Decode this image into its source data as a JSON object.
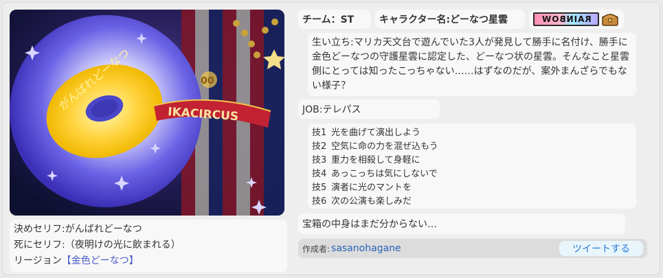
{
  "image": {
    "arc_text": "がんばれどーなつ",
    "banner_text": "IKACIRCUS",
    "badge_text": "00"
  },
  "quotes": {
    "kime_label": "決めセリフ:",
    "kime": "がんばれどーなつ",
    "shini_label": "死にセリフ:",
    "shini": "（夜明けの光に飲まれる）",
    "region_label": "リージョン",
    "region": "【金色どーなつ】"
  },
  "team": {
    "label": "チーム：ST"
  },
  "character": {
    "label": "キャラクター名:どーなつ星雲"
  },
  "badges": {
    "rainbow": "RAINBOW",
    "chest_icon": "treasure-chest"
  },
  "origin": {
    "text": "生い立ち:マリカ天文台で遊んでいた3人が発見して勝手に名付け、勝手に金色どーなつの守護星雲に認定した、どーなつ状の星雲。そんなこと星雲側にとっては知ったこっちゃない……はずなのだが、案外まんざらでもない様子？"
  },
  "job": {
    "text": "JOB:テレパス"
  },
  "skills": [
    {
      "key": "技1",
      "name": "光を曲げて演出しよう"
    },
    {
      "key": "技2",
      "name": "空気に命の力を混ぜ込もう"
    },
    {
      "key": "技3",
      "name": "重力を相殺して身軽に"
    },
    {
      "key": "技4",
      "name": "あっこっちは気にしないで"
    },
    {
      "key": "技5",
      "name": "演者に光のマントを"
    },
    {
      "key": "技6",
      "name": "次の公演も楽しみだ"
    }
  ],
  "treasure": {
    "text": "宝箱の中身はまだ分からない…"
  },
  "footer": {
    "author_label": "作成者:",
    "author": "sasanohagane",
    "tweet": "ツイートする"
  },
  "colors": {
    "accent_link": "#2a62b8",
    "region_link": "#4a5cc8",
    "tweet_bg": "#e8f6fc"
  }
}
